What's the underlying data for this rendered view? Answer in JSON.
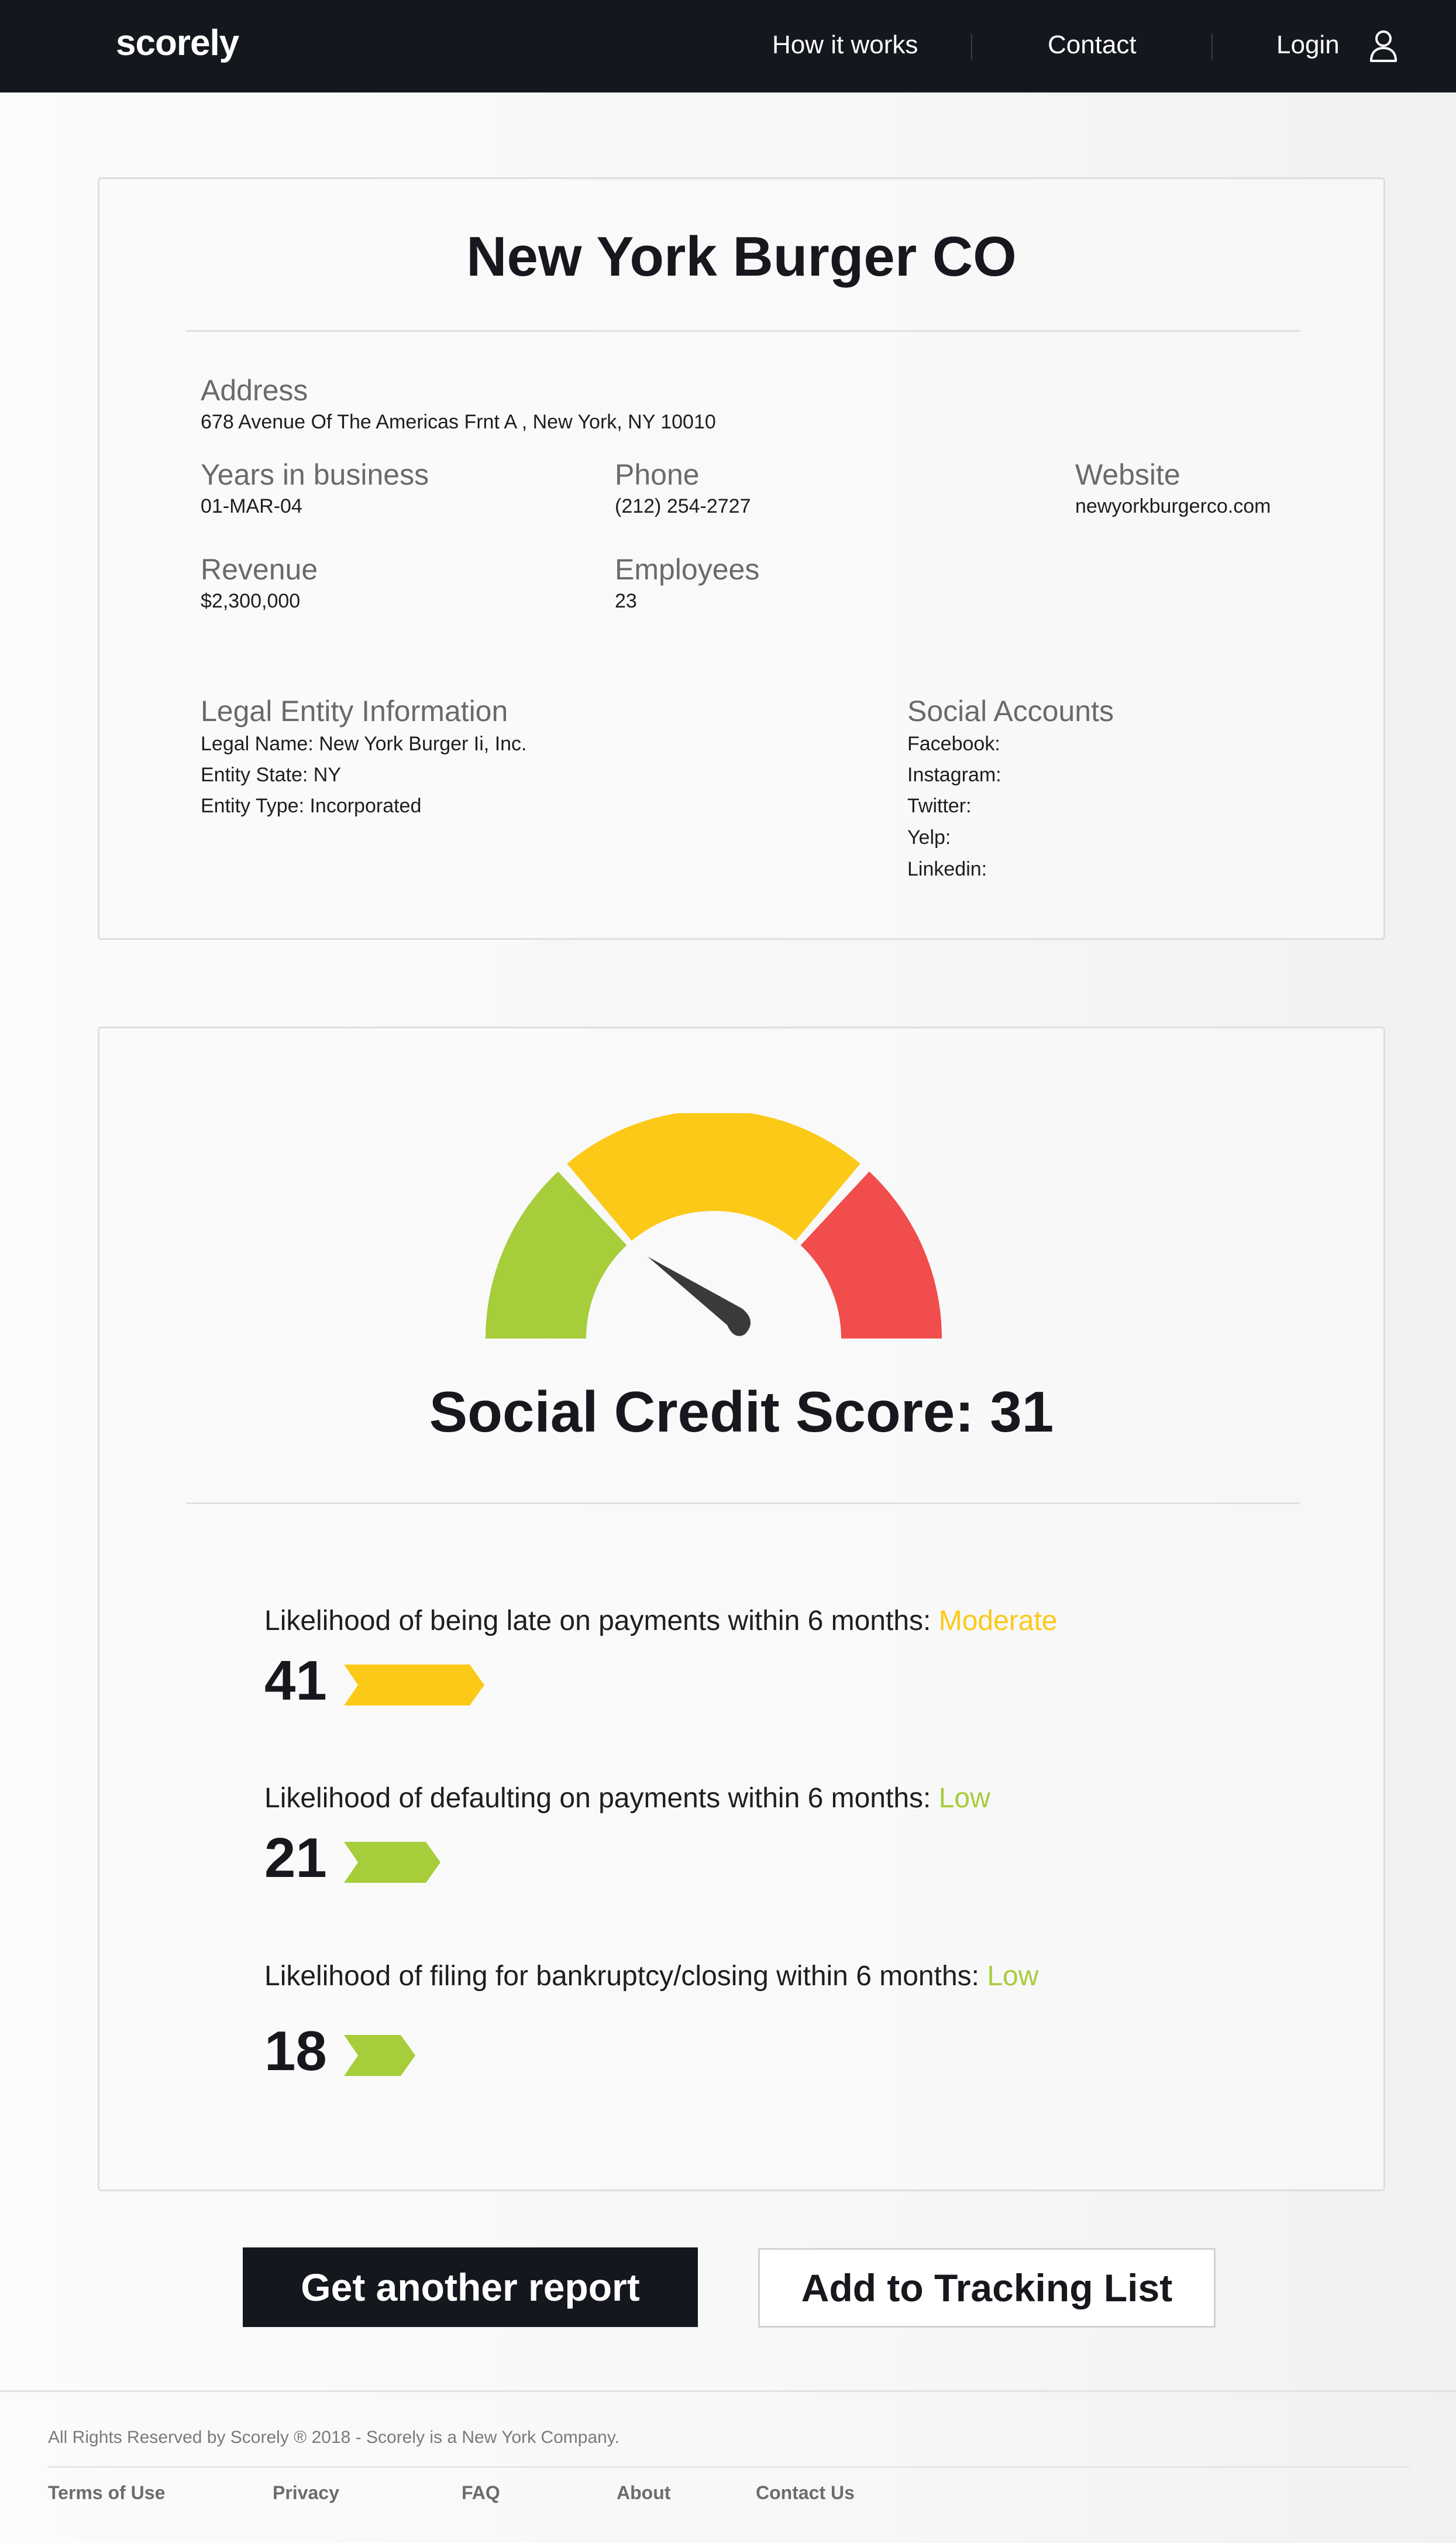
{
  "nav": {
    "logo": "scorely",
    "links": [
      "How it works",
      "Contact"
    ],
    "login": "Login"
  },
  "company": {
    "name": "New York Burger CO",
    "address_label": "Address",
    "address": "678 Avenue Of The Americas Frnt A , New York, NY 10010",
    "years_label": "Years in business",
    "years": "01-MAR-04",
    "phone_label": "Phone",
    "phone": "(212) 254-2727",
    "website_label": "Website",
    "website": "newyorkburgerco.com",
    "revenue_label": "Revenue",
    "revenue": "$2,300,000",
    "employees_label": "Employees",
    "employees": "23",
    "legal_label": "Legal Entity Information",
    "legal_lines": [
      "Legal Name: New York Burger Ii, Inc.",
      "Entity State: NY",
      "Entity Type: Incorporated"
    ],
    "social_label": "Social Accounts",
    "social_lines": [
      "Facebook:",
      "Instagram:",
      "Twitter:",
      "Yelp:",
      "Linkedin:"
    ]
  },
  "score": {
    "title": "Social Credit Score: 31",
    "gauge_colors": [
      "#a6cd3a",
      "#fcc918",
      "#f04d4c"
    ],
    "metrics": [
      {
        "label": "Likelihood of being late on payments within 6 months: ",
        "level": "Moderate",
        "level_color": "#fcc918",
        "value": "41"
      },
      {
        "label": "Likelihood of defaulting on payments within 6 months: ",
        "level": "Low",
        "level_color": "#a6cd3a",
        "value": "21"
      },
      {
        "label": "Likelihood of filing for bankruptcy/closing within 6 months: ",
        "level": "Low",
        "level_color": "#a6cd3a",
        "value": "18"
      }
    ]
  },
  "buttons": {
    "primary": "Get another report",
    "secondary": "Add to Tracking List"
  },
  "footer": {
    "copyright": "All Rights Reserved by Scorely ® 2018 - Scorely is a New York Company.",
    "links": [
      "Terms of Use",
      "Privacy",
      "FAQ",
      "About",
      "Contact Us"
    ]
  }
}
